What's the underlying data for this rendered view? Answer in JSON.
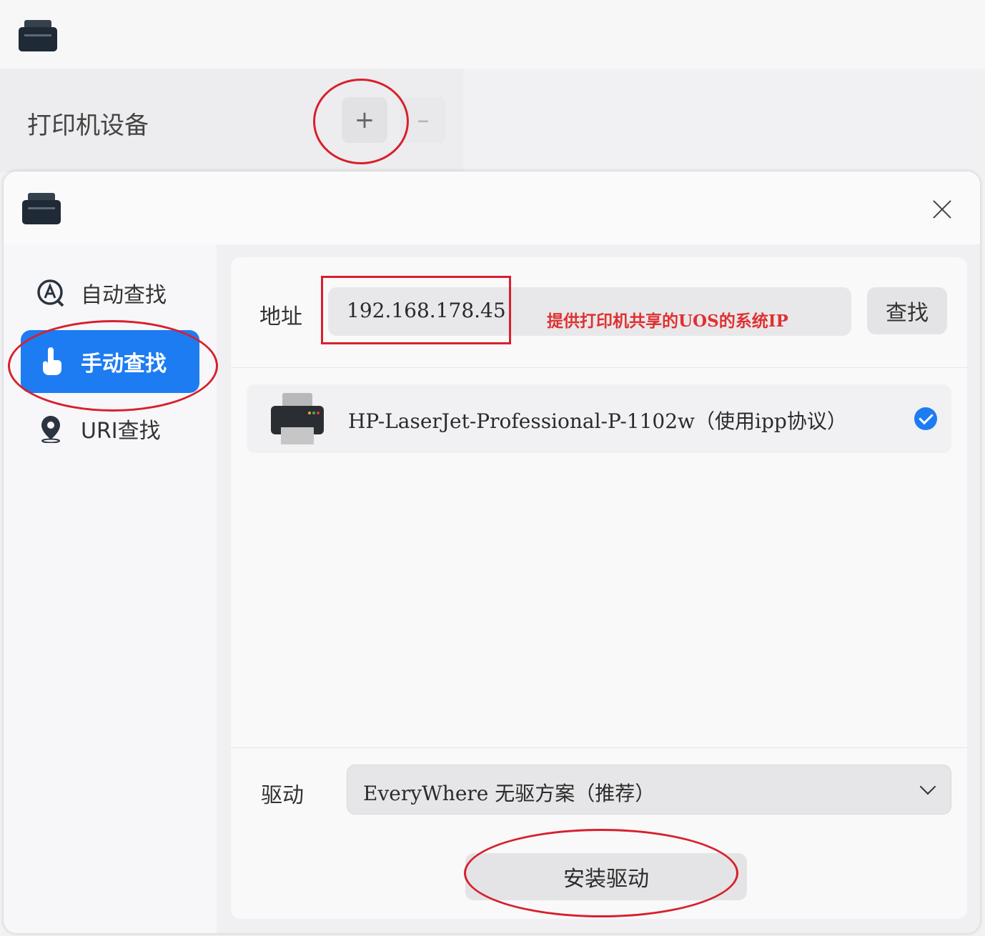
{
  "background_window": {
    "title": "打印机设备",
    "add_button": "+",
    "remove_button": "–"
  },
  "dialog": {
    "close_icon": "close-icon",
    "sidebar": {
      "items": [
        {
          "label": "自动查找",
          "icon": "auto-search-icon",
          "active": false
        },
        {
          "label": "手动查找",
          "icon": "hand-pointer-icon",
          "active": true
        },
        {
          "label": "URI查找",
          "icon": "location-pin-icon",
          "active": false
        }
      ]
    },
    "address": {
      "label": "地址",
      "value": "192.168.178.45",
      "annotation": "提供打印机共享的UOS的系统IP",
      "find_button": "查找"
    },
    "results": [
      {
        "name": "HP-LaserJet-Professional-P-1102w（使用ipp协议）",
        "selected": true
      }
    ],
    "driver": {
      "label": "驱动",
      "selected": "EveryWhere 无驱方案（推荐）"
    },
    "install_button": "安装驱动"
  },
  "colors": {
    "accent": "#1d7cf2",
    "annotation_red": "#d8202c"
  }
}
